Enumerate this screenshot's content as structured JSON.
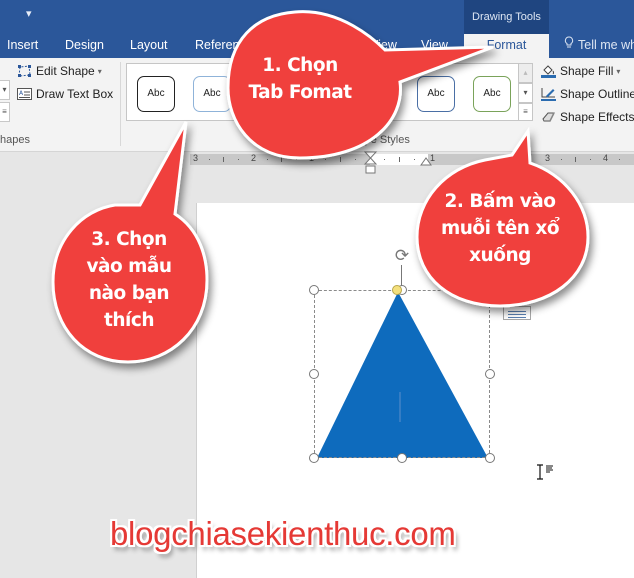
{
  "titlebar": {
    "qat_icon": "customize-quick-access-icon",
    "context_header": "Drawing Tools"
  },
  "tabs": [
    {
      "label": "Insert",
      "active": false
    },
    {
      "label": "Design",
      "active": false
    },
    {
      "label": "Layout",
      "active": false
    },
    {
      "label": "Referen",
      "active": false
    },
    {
      "label": "View",
      "active": false
    },
    {
      "label": "View",
      "active": false
    },
    {
      "label": "Format",
      "active": true
    }
  ],
  "tell_me": {
    "label": "Tell me wh",
    "icon": "lightbulb-icon"
  },
  "ribbon": {
    "insert_shapes": {
      "group_label": "hapes",
      "edit_shape": "Edit Shape",
      "draw_text_box": "Draw Text Box"
    },
    "shape_styles": {
      "group_label": "Shape Styles",
      "swatch_label": "Abc",
      "swatches": [
        {
          "label": "Abc",
          "border": "#222222"
        },
        {
          "label": "Abc",
          "border": "#8fb3d9"
        },
        {
          "label": "Abc",
          "border": "#e8c84a"
        },
        {
          "label": "Abc",
          "border": "#4a6fa5"
        },
        {
          "label": "Abc",
          "border": "#7aa35a"
        }
      ],
      "shape_fill": "Shape Fill",
      "shape_outline": "Shape Outline",
      "shape_effects": "Shape Effects"
    }
  },
  "ruler": {
    "numbers": [
      "3",
      "2",
      "1",
      "1",
      "3",
      "4"
    ]
  },
  "document": {
    "shape": "isosceles-triangle",
    "shape_color": "#0e6bbd"
  },
  "callouts": [
    {
      "id": "step-1",
      "text": "1. Chọn\nTab Fomat"
    },
    {
      "id": "step-2",
      "text": "2. Bấm vào\nmuỗi tên xổ\nxuống"
    },
    {
      "id": "step-3",
      "text": "3. Chọn\nvào mẫu\nnào bạn\nthích"
    }
  ],
  "callout_color": "#f0403e",
  "watermark": "blogchiasekienthuc.com"
}
